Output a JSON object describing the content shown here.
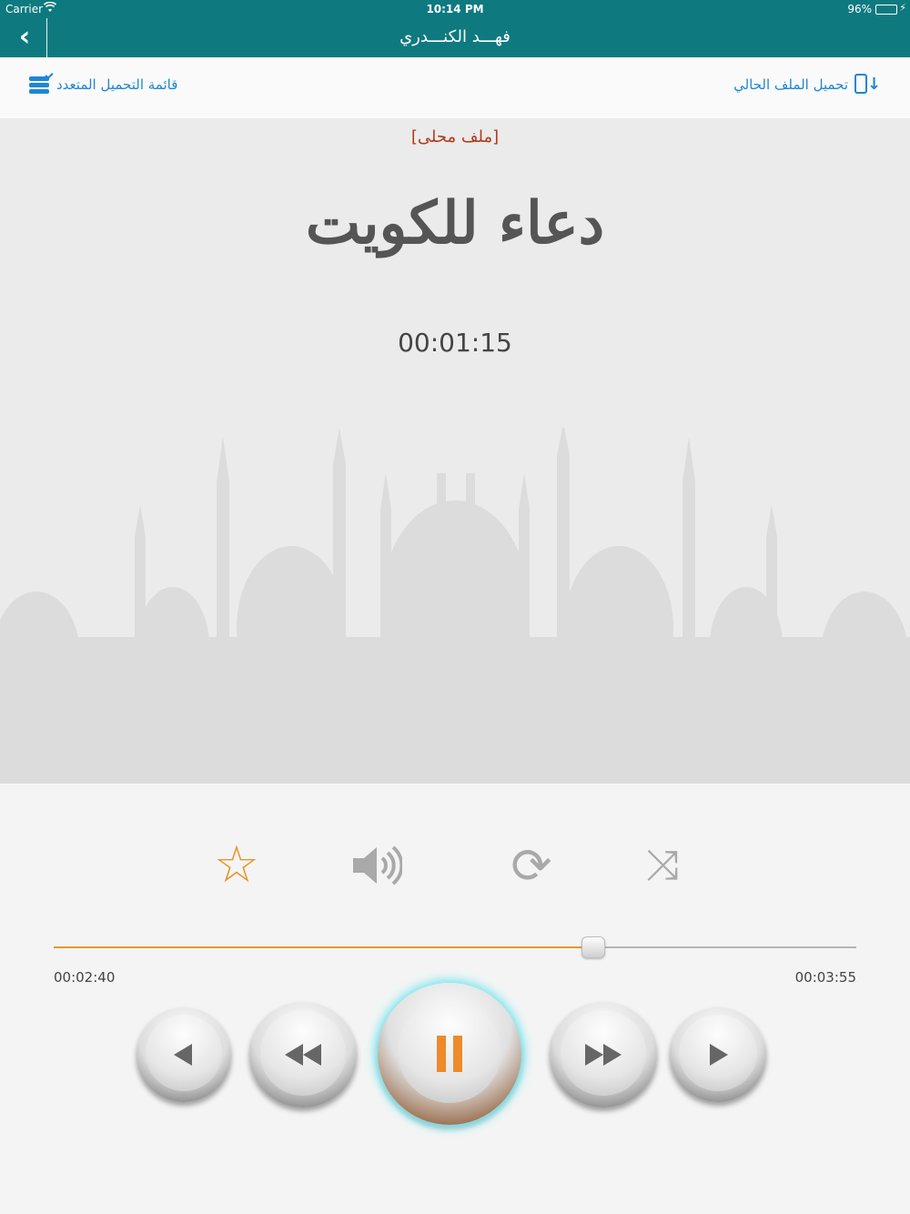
{
  "status_bar": {
    "carrier": "Carrier",
    "time": "10:14 PM",
    "battery": "96%"
  },
  "nav": {
    "title": "فهـــد الكنـــدري"
  },
  "actions": {
    "multi_download": "قائمة التحميل المتعدد",
    "download_current": "تحميل الملف الحالي"
  },
  "player": {
    "local_tag": "[ملف محلى]",
    "track_title": "دعاء للكويت",
    "elapsed_big": "00:01:15",
    "time_elapsed": "00:02:40",
    "time_total": "00:03:55",
    "progress_fraction": 0.672
  },
  "icons": {
    "favorite": "star-icon",
    "volume": "volume-icon",
    "repeat": "repeat-icon",
    "shuffle": "shuffle-icon"
  },
  "colors": {
    "header": "#0e7a80",
    "accent": "#e7962b",
    "link": "#1e86d6",
    "local_tag": "#b33a1b"
  }
}
